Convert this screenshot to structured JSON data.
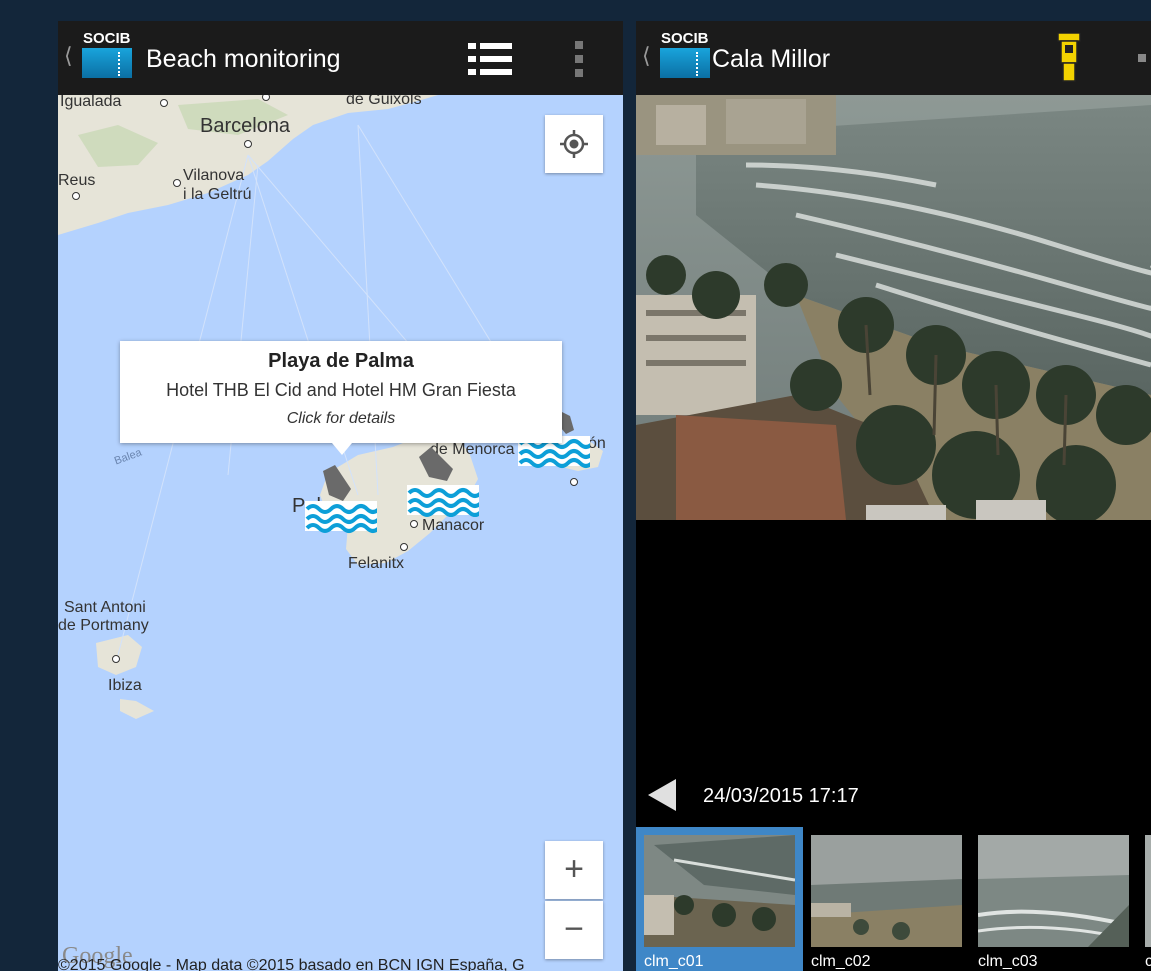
{
  "left_app": {
    "title": "Beach monitoring",
    "logo_text": "SOCIB",
    "map": {
      "labels": {
        "igualada": "Igualada",
        "guixols": "de Guixols",
        "barcelona": "Barcelona",
        "reus": "Reus",
        "vilanova1": "Vilanova",
        "vilanova2": "i la Geltrú",
        "palma": "Palma",
        "manacor": "Manacor",
        "felanitx": "Felanitx",
        "menorca": "de Menorca",
        "mahon": "ón",
        "santantoni1": "Sant Antoni",
        "santantoni2": "de Portmany",
        "ibiza": "Ibiza",
        "balearic": "Balea",
        "google": "Google",
        "copyright": "©2015 Google - Map data ©2015 basado en BCN IGN España, G"
      },
      "zoom_in": "+",
      "zoom_out": "−"
    },
    "info_window": {
      "name": "Playa de Palma",
      "description": "Hotel THB El Cid and Hotel HM Gran Fiesta",
      "hint": "Click for details"
    }
  },
  "right_app": {
    "title": "Cala Millor",
    "logo_text": "SOCIB",
    "timestamp": "24/03/2015 17:17",
    "thumbnails": [
      {
        "label": "clm_c01",
        "selected": true
      },
      {
        "label": "clm_c02",
        "selected": false
      },
      {
        "label": "clm_c03",
        "selected": false
      },
      {
        "label": "c",
        "selected": false
      }
    ]
  },
  "colors": {
    "background": "#13263a",
    "appbar": "#1b1b1b",
    "sea": "#b4d2fe",
    "selected_thumb": "#3f87c7"
  }
}
